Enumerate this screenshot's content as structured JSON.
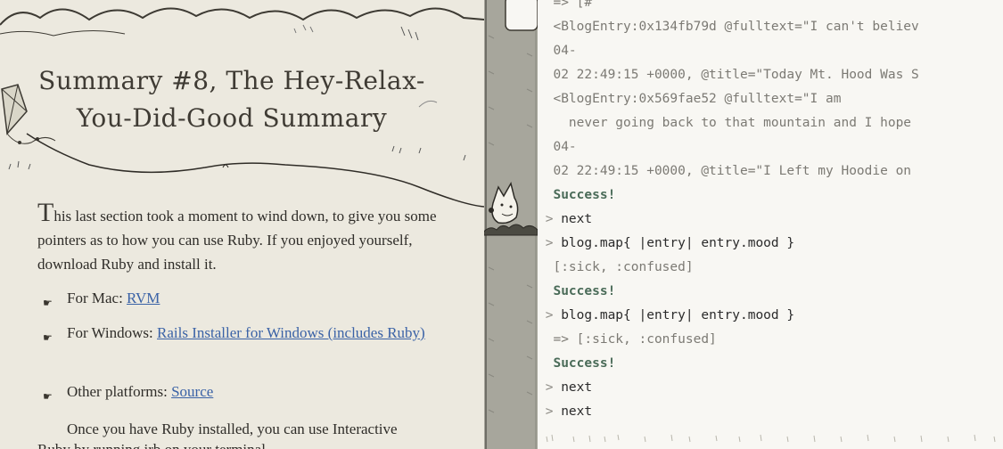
{
  "lesson": {
    "title_line1": "Summary #8, The Hey-Relax-",
    "title_line2": "You-Did-Good Summary",
    "intro_dropcap": "T",
    "intro_rest": "his last section took a moment to wind down, to give you some pointers as to how you can use Ruby. If you enjoyed yourself, download Ruby and install it.",
    "bullets": [
      {
        "prefix": "For Mac: ",
        "link": "RVM"
      },
      {
        "prefix": "For Windows: ",
        "link": "Rails Installer for Windows (includes Ruby)"
      },
      {
        "prefix": "Other platforms: ",
        "link": "Source"
      }
    ],
    "tail": "Once you have Ruby installed, you can use Interactive",
    "tail2": "Ruby by running irb on your terminal..."
  },
  "console": {
    "lines": [
      {
        "type": "out",
        "text": "  => [#"
      },
      {
        "type": "out",
        "text": "  <BlogEntry:0x134fb79d @fulltext=\"I can't believ"
      },
      {
        "type": "out",
        "text": "  04-"
      },
      {
        "type": "out",
        "text": "  02 22:49:15 +0000, @title=\"Today Mt. Hood Was S"
      },
      {
        "type": "out",
        "text": "  <BlogEntry:0x569fae52 @fulltext=\"I am"
      },
      {
        "type": "out",
        "text": "    never going back to that mountain and I hope"
      },
      {
        "type": "out",
        "text": "  04-"
      },
      {
        "type": "out",
        "text": "  02 22:49:15 +0000, @title=\"I Left my Hoodie on"
      },
      {
        "type": "succ",
        "text": "  Success!"
      },
      {
        "type": "in",
        "prompt": ">",
        "text": "next"
      },
      {
        "type": "in",
        "prompt": ">",
        "text": "blog.map{ |entry| entry.mood }"
      },
      {
        "type": "out",
        "text": "  [:sick, :confused]"
      },
      {
        "type": "succ",
        "text": "  Success!"
      },
      {
        "type": "in",
        "prompt": ">",
        "text": "blog.map{ |entry| entry.mood }"
      },
      {
        "type": "out",
        "text": "  => [:sick, :confused]"
      },
      {
        "type": "succ",
        "text": "  Success!"
      },
      {
        "type": "in",
        "prompt": ">",
        "text": "next"
      },
      {
        "type": "in",
        "prompt": ">",
        "text": "next"
      }
    ]
  }
}
